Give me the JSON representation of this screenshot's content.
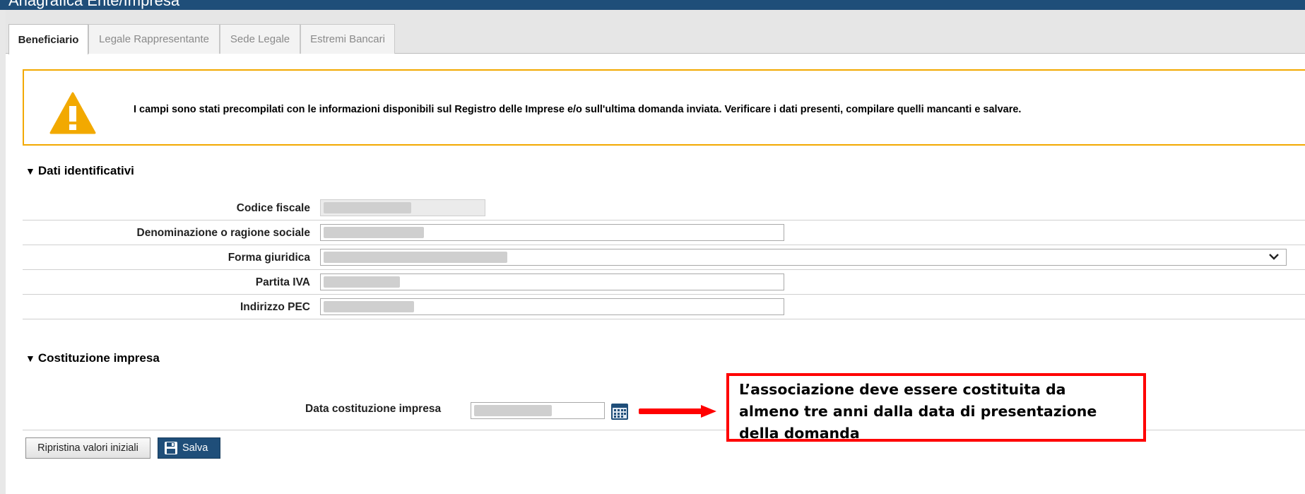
{
  "window": {
    "title": "Anagrafica Ente/Impresa"
  },
  "tabs": [
    {
      "label": "Beneficiario",
      "active": true
    },
    {
      "label": "Legale Rappresentante",
      "active": false
    },
    {
      "label": "Sede Legale",
      "active": false
    },
    {
      "label": "Estremi Bancari",
      "active": false
    }
  ],
  "warning": {
    "text": "I campi sono stati precompilati con le informazioni disponibili sul Registro delle Imprese e/o sull'ultima domanda inviata. Verificare i dati presenti, compilare quelli mancanti e salvare.",
    "color": "#f2a900"
  },
  "sections": {
    "identificativi": "Dati identificativi",
    "costituzione": "Costituzione impresa"
  },
  "fields": {
    "codice_fiscale": {
      "label": "Codice fiscale"
    },
    "denominazione": {
      "label": "Denominazione o ragione sociale"
    },
    "forma_giuridica": {
      "label": "Forma giuridica"
    },
    "partita_iva": {
      "label": "Partita IVA"
    },
    "pec": {
      "label": "Indirizzo PEC"
    },
    "data_costituzione": {
      "label": "Data costituzione impresa"
    }
  },
  "callout": {
    "line1": "L’associazione deve essere costituita da",
    "line2": "almeno tre anni dalla data di presentazione",
    "line3": "della domanda",
    "color": "#ff0000"
  },
  "buttons": {
    "reset": "Ripristina valori iniziali",
    "save": "Salva"
  },
  "colors": {
    "primary": "#1f4e79"
  }
}
